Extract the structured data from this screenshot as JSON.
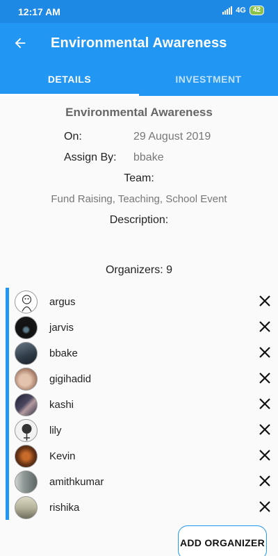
{
  "status": {
    "time": "12:17 AM",
    "network": "4G",
    "battery": "42"
  },
  "app_bar": {
    "title": "Environmental Awareness"
  },
  "tabs": [
    {
      "label": "DETAILS",
      "active": true
    },
    {
      "label": "INVESTMENT",
      "active": false
    }
  ],
  "details": {
    "event_title": "Environmental Awareness",
    "on_label": "On:",
    "on_value": "29 August 2019",
    "assign_label": "Assign By:",
    "assign_value": "bbake",
    "team_label": "Team:",
    "team_value": "Fund Raising, Teaching, School Event",
    "description_label": "Description:"
  },
  "organizers": {
    "count_text": "Organizers: 9",
    "items": [
      {
        "name": "argus",
        "avatar_color": "#ffffff"
      },
      {
        "name": "jarvis",
        "avatar_color": "#1a1a1a"
      },
      {
        "name": "bbake",
        "avatar_color": "#3b4a5a"
      },
      {
        "name": "gigihadid",
        "avatar_color": "#c9a48f"
      },
      {
        "name": "kashi",
        "avatar_color": "#2b2f45"
      },
      {
        "name": "lily",
        "avatar_color": "#f2f2f2"
      },
      {
        "name": "Kevin",
        "avatar_color": "#4a2a18"
      },
      {
        "name": "amithkumar",
        "avatar_color": "#9aa1a0"
      },
      {
        "name": "rishika",
        "avatar_color": "#b7b39a"
      }
    ]
  },
  "actions": {
    "add_organizer": "ADD ORGANIZER"
  },
  "colors": {
    "primary": "#2196f3",
    "status_bar": "#1e88e5"
  }
}
